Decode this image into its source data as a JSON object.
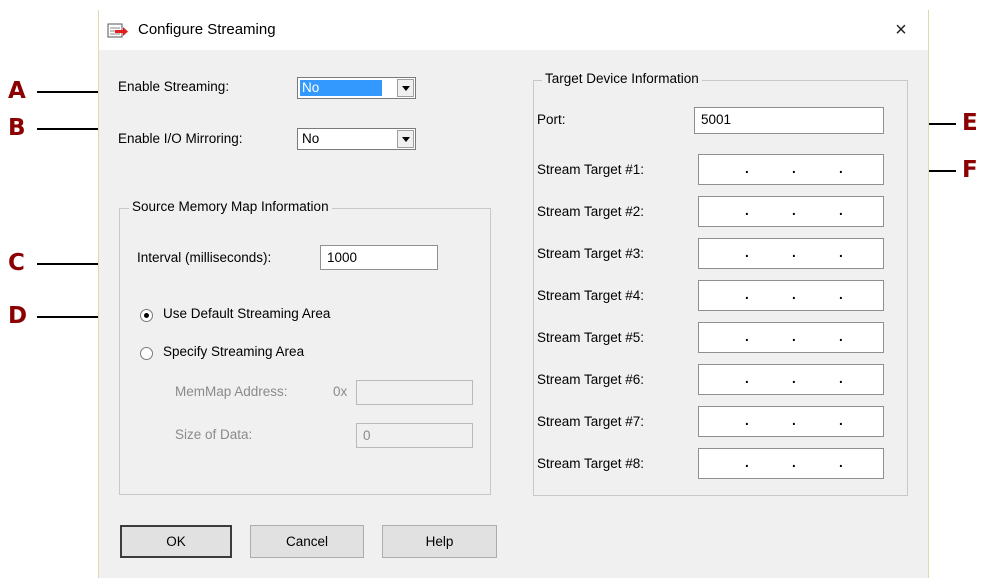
{
  "window": {
    "title": "Configure Streaming",
    "close_glyph": "×",
    "app_icon": "streaming-config-icon"
  },
  "streaming": {
    "enable_label": "Enable Streaming:",
    "enable_value": "No",
    "mirroring_label": "Enable I/O Mirroring:",
    "mirroring_value": "No"
  },
  "source": {
    "group_title": "Source Memory Map Information",
    "interval_label": "Interval (milliseconds):",
    "interval_value": "1000",
    "radio_default_label": "Use Default Streaming Area",
    "radio_specify_label": "Specify Streaming Area",
    "selected": "default",
    "memmap_label": "MemMap Address:",
    "memmap_prefix": "0x",
    "memmap_value": "",
    "size_label": "Size of Data:",
    "size_value": "0"
  },
  "target": {
    "group_title": "Target Device Information",
    "port_label": "Port:",
    "port_value": "5001",
    "stream_targets": [
      "Stream Target #1:",
      "Stream Target #2:",
      "Stream Target #3:",
      "Stream Target #4:",
      "Stream Target #5:",
      "Stream Target #6:",
      "Stream Target #7:",
      "Stream Target #8:"
    ],
    "ip_separator": "."
  },
  "buttons": {
    "ok": "OK",
    "cancel": "Cancel",
    "help": "Help"
  },
  "callouts": {
    "a": "A",
    "b": "B",
    "c": "C",
    "d": "D",
    "e": "E",
    "f": "F"
  },
  "colors": {
    "callout": "#8b0000",
    "selection": "#3399ff",
    "dialog_bg": "#f0f0f0"
  }
}
